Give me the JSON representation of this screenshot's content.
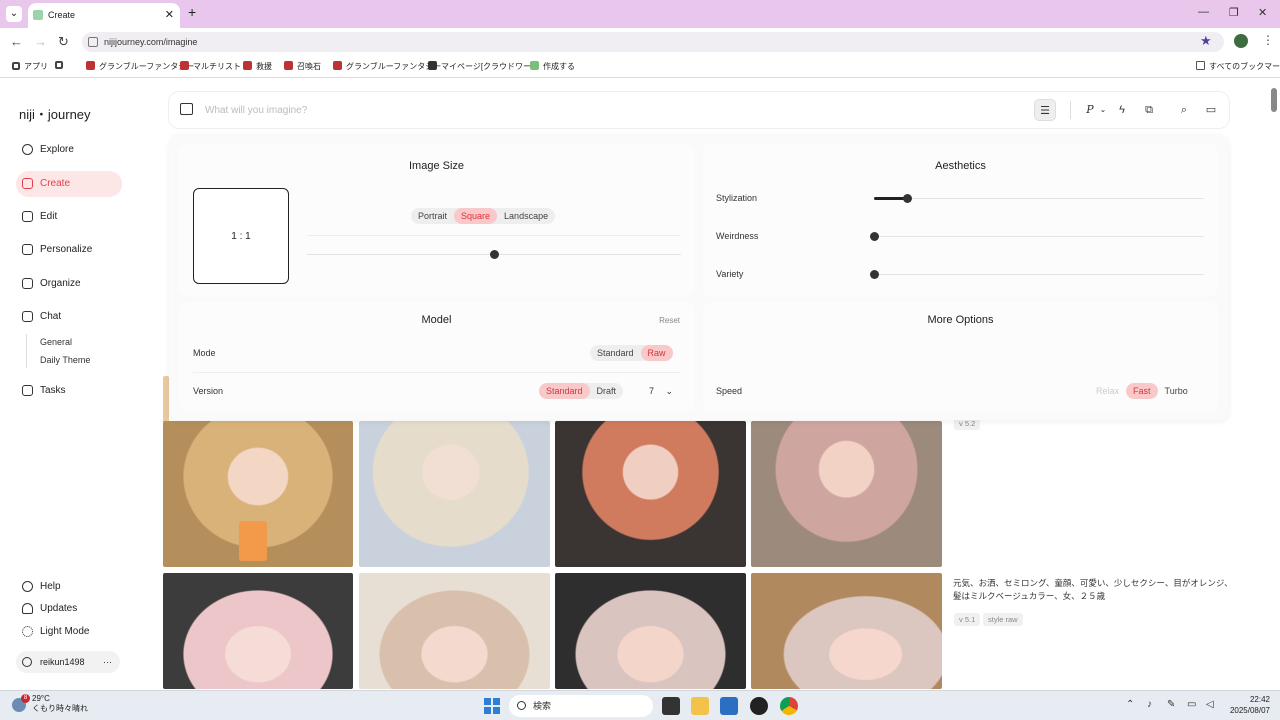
{
  "browser": {
    "tab_title": "Create",
    "url": "nijijourney.com/imagine",
    "bookmarks": [
      "アプリ",
      "グランブルーファンタジー",
      "マルチリスト",
      "救援",
      "召喚石",
      "グランブルーファンタジー",
      "マイページ[クラウドワー…",
      "作成する"
    ],
    "all_bookmarks": "すべてのブックマーク"
  },
  "app": {
    "logo": "niji・journey"
  },
  "sidebar": {
    "items": [
      {
        "label": "Explore"
      },
      {
        "label": "Create"
      },
      {
        "label": "Edit"
      },
      {
        "label": "Personalize"
      },
      {
        "label": "Organize"
      },
      {
        "label": "Chat"
      },
      {
        "label": "Tasks"
      }
    ],
    "chat_sub": [
      "General",
      "Daily Theme"
    ],
    "bottom": [
      {
        "label": "Help"
      },
      {
        "label": "Updates"
      },
      {
        "label": "Light Mode"
      }
    ],
    "username": "reikun1498",
    "more": "···"
  },
  "prompt": {
    "placeholder": "What will you imagine?"
  },
  "image_size": {
    "title": "Image Size",
    "ratio": "1 : 1",
    "orientations": [
      "Portrait",
      "Square",
      "Landscape"
    ],
    "selected": "Square",
    "slider_value": 0.5
  },
  "aesthetics": {
    "title": "Aesthetics",
    "sliders": [
      {
        "label": "Stylization",
        "value": 0.1
      },
      {
        "label": "Weirdness",
        "value": 0
      },
      {
        "label": "Variety",
        "value": 0
      }
    ]
  },
  "model": {
    "title": "Model",
    "reset": "Reset",
    "mode_label": "Mode",
    "modes": [
      "Standard",
      "Raw"
    ],
    "mode_selected": "Raw",
    "version_label": "Version",
    "versions": [
      "Standard",
      "Draft"
    ],
    "version_selected": "Standard",
    "version_number": "7"
  },
  "more_options": {
    "title": "More Options",
    "speed_label": "Speed",
    "speeds": [
      "Relax",
      "Fast",
      "Turbo"
    ],
    "speed_selected": "Fast"
  },
  "feed": {
    "tag_top": "v 5.2",
    "caption": "元気、お洒、セミロング、童顔、可愛い、少しセクシー、目がオレンジ、髪はミルクベージュカラー、女、２５歳",
    "tags": [
      "v 5.1",
      "style raw"
    ]
  },
  "taskbar": {
    "weather_temp": "29°C",
    "weather_desc": "くもり時々晴れ",
    "weather_badge": "8",
    "search": "検索",
    "time": "22:42",
    "date": "2025/08/07"
  },
  "colors": {
    "accent": "#e2434b",
    "accent_bg": "#f9c9ca"
  }
}
